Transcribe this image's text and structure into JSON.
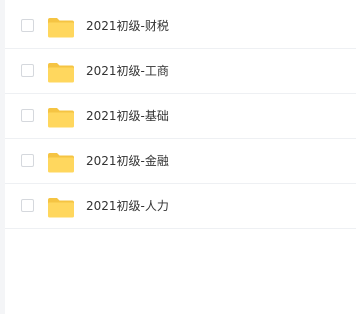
{
  "files": [
    {
      "name": "2021初级-财税",
      "icon": "folder-icon"
    },
    {
      "name": "2021初级-工商",
      "icon": "folder-icon"
    },
    {
      "name": "2021初级-基础",
      "icon": "folder-icon"
    },
    {
      "name": "2021初级-金融",
      "icon": "folder-icon"
    },
    {
      "name": "2021初级-人力",
      "icon": "folder-icon"
    }
  ],
  "colors": {
    "folder": "#FFD75E",
    "folder_tab": "#F5C443",
    "text": "#333333",
    "divider": "#EEF0F3",
    "checkbox_border": "#D5D8DD"
  }
}
